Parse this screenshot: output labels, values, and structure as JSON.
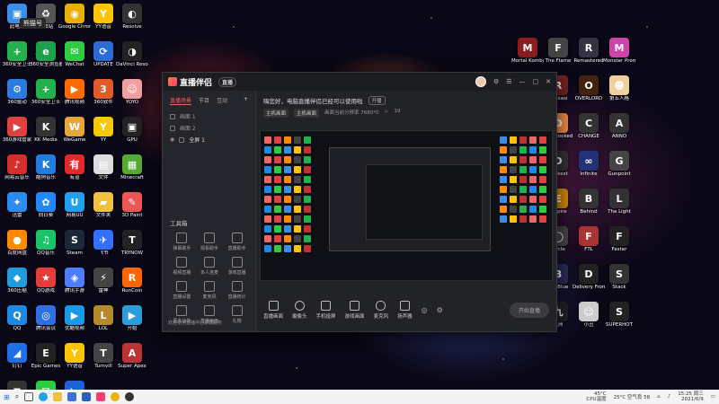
{
  "overlay": {
    "tag": "熊猫号"
  },
  "desktop_left": [
    [
      {
        "label": "此电脑",
        "color": "#3a8ee6",
        "glyph": "▣"
      },
      {
        "label": "360安全卫士",
        "color": "#22b14c",
        "glyph": "+"
      },
      {
        "label": "360驱动",
        "color": "#2d7be0",
        "glyph": "⚙"
      },
      {
        "label": "360游戏管家",
        "color": "#e04040",
        "glyph": "▶"
      },
      {
        "label": "网易云音乐",
        "color": "#d62d2d",
        "glyph": "♪"
      },
      {
        "label": "迅雷",
        "color": "#2a8cf0",
        "glyph": "✦"
      },
      {
        "label": "百度网盘",
        "color": "#ff8a00",
        "glyph": "●"
      },
      {
        "label": "360压缩",
        "color": "#1f9bde",
        "glyph": "◆"
      },
      {
        "label": "QQ",
        "color": "#1e88e5",
        "glyph": "Q"
      },
      {
        "label": "钉钉",
        "color": "#1d6fe8",
        "glyph": "◢"
      },
      {
        "label": "PS4",
        "color": "#333",
        "glyph": "◼"
      }
    ],
    [
      {
        "label": "回收站",
        "color": "#555",
        "glyph": "♻"
      },
      {
        "label": "360安全浏览器",
        "color": "#1da14a",
        "glyph": "e"
      },
      {
        "label": "360安全卫士",
        "color": "#22b14c",
        "glyph": "+"
      },
      {
        "label": "KK Media",
        "color": "#333",
        "glyph": "K"
      },
      {
        "label": "酷狗音乐",
        "color": "#1f7de0",
        "glyph": "K"
      },
      {
        "label": "向日葵",
        "color": "#2288ff",
        "glyph": "✿"
      },
      {
        "label": "QQ音乐",
        "color": "#19c36a",
        "glyph": "♫"
      },
      {
        "label": "QQ游戏",
        "color": "#e63b3b",
        "glyph": "★"
      },
      {
        "label": "腾讯会议",
        "color": "#2f6fe4",
        "glyph": "◎"
      },
      {
        "label": "Epic Games",
        "color": "#222",
        "glyph": "E"
      },
      {
        "label": "微信",
        "color": "#2ecc40",
        "glyph": "✉"
      }
    ],
    [
      {
        "label": "Google Chrome",
        "color": "#e8b004",
        "glyph": "◉"
      },
      {
        "label": "WeChat",
        "color": "#2ecc40",
        "glyph": "✉"
      },
      {
        "label": "腾讯视频",
        "color": "#ff6b00",
        "glyph": "▶"
      },
      {
        "label": "WeGame",
        "color": "#e6a63a",
        "glyph": "W"
      },
      {
        "label": "有道",
        "color": "#e02a2a",
        "glyph": "有"
      },
      {
        "label": "网易UU",
        "color": "#21a0f0",
        "glyph": "U"
      },
      {
        "label": "Steam",
        "color": "#1b2838",
        "glyph": "S"
      },
      {
        "label": "腾讯手游",
        "color": "#4d7cff",
        "glyph": "◈"
      },
      {
        "label": "优酷视频",
        "color": "#1a9ae6",
        "glyph": "▶"
      },
      {
        "label": "YY语音",
        "color": "#ffc400",
        "glyph": "Y"
      },
      {
        "label": "腾讯游戏",
        "color": "#1e63d6",
        "glyph": "◣"
      }
    ],
    [
      {
        "label": "YY语音",
        "color": "#ffc400",
        "glyph": "Y"
      },
      {
        "label": "UPDATE",
        "color": "#2b6bd6",
        "glyph": "⟳"
      },
      {
        "label": "360软件",
        "color": "#e05a2a",
        "glyph": "3"
      },
      {
        "label": "YY",
        "color": "#f5c800",
        "glyph": "Y"
      },
      {
        "label": "文件",
        "color": "#ddd",
        "glyph": "▤"
      },
      {
        "label": "文件夹",
        "color": "#f0c040",
        "glyph": "▰"
      },
      {
        "label": "飞书",
        "color": "#3370ff",
        "glyph": "✈"
      },
      {
        "label": "雷神",
        "color": "#444",
        "glyph": "⚡"
      },
      {
        "label": "LOL",
        "color": "#b48a2c",
        "glyph": "L"
      },
      {
        "label": "Turnvill",
        "color": "#444",
        "glyph": "T"
      }
    ],
    [
      {
        "label": "Resolve",
        "color": "#333",
        "glyph": "◐"
      },
      {
        "label": "DaVinci Resolve",
        "color": "#222",
        "glyph": "◑"
      },
      {
        "label": "YOYO",
        "color": "#f0a0a0",
        "glyph": "☺"
      },
      {
        "label": "GPU",
        "color": "#222",
        "glyph": "▣"
      },
      {
        "label": "Minecraft",
        "color": "#5a3",
        "glyph": "▦"
      },
      {
        "label": "3D Paint",
        "color": "#e55",
        "glyph": "✎"
      },
      {
        "label": "TRYNOW",
        "color": "#222",
        "glyph": "T"
      },
      {
        "label": "RunCoin",
        "color": "#f60",
        "glyph": "R"
      },
      {
        "label": "开始",
        "color": "#2d9cdb",
        "glyph": "▶"
      },
      {
        "label": "Super Apex",
        "color": "#b33",
        "glyph": "A"
      }
    ]
  ],
  "desktop_right": [
    [
      {
        "label": "Mortal Kombat",
        "color": "#8a1e1e",
        "glyph": "M"
      },
      {
        "label": "Merge",
        "color": "#e66",
        "glyph": "✚"
      },
      {
        "label": "游戏",
        "color": "#b33",
        "glyph": "◆"
      },
      {
        "label": "Conqueror",
        "color": "#6a4",
        "glyph": "C"
      },
      {
        "label": "BIOLOGY",
        "color": "#333",
        "glyph": "B"
      },
      {
        "label": "Not For Broadcast",
        "color": "#c33",
        "glyph": "N"
      },
      {
        "label": "Shattered",
        "color": "#3a5ba0",
        "glyph": "S"
      },
      {
        "label": "Punch Club",
        "color": "#a22",
        "glyph": "P"
      }
    ],
    [
      {
        "label": "The Flame",
        "color": "#444",
        "glyph": "F"
      },
      {
        "label": "Raksasi",
        "color": "#722",
        "glyph": "R"
      },
      {
        "label": "Overcooked",
        "color": "#e84",
        "glyph": "O"
      },
      {
        "label": "Darkest",
        "color": "#333",
        "glyph": "D"
      },
      {
        "label": "Empire",
        "color": "#c80",
        "glyph": "E"
      },
      {
        "label": "Circle",
        "color": "#444",
        "glyph": "◯"
      },
      {
        "label": "Big Blue",
        "color": "#2a2a5a",
        "glyph": "B"
      },
      {
        "label": "九州",
        "color": "#222",
        "glyph": "九"
      }
    ],
    [
      {
        "label": "Remastered",
        "color": "#334",
        "glyph": "R"
      },
      {
        "label": "OVERLORD",
        "color": "#421",
        "glyph": "O"
      },
      {
        "label": "CHANGE",
        "color": "#333",
        "glyph": "C"
      },
      {
        "label": "Infinite",
        "color": "#237",
        "glyph": "∞"
      },
      {
        "label": "Behind",
        "color": "#333",
        "glyph": "B"
      },
      {
        "label": "FTL",
        "color": "#a33",
        "glyph": "F"
      },
      {
        "label": "Delivery From",
        "color": "#222",
        "glyph": "D"
      },
      {
        "label": "小丑",
        "color": "#ccc",
        "glyph": "☺"
      }
    ],
    [
      {
        "label": "Monster Prom",
        "color": "#c4a",
        "glyph": "M"
      },
      {
        "label": "第五人格",
        "color": "#f0d0a0",
        "glyph": "☻"
      },
      {
        "label": "ANNO",
        "color": "#333",
        "glyph": "A"
      },
      {
        "label": "Gunpoint",
        "color": "#444",
        "glyph": "G"
      },
      {
        "label": "The Light",
        "color": "#333",
        "glyph": "L"
      },
      {
        "label": "Faster",
        "color": "#222",
        "glyph": "F"
      },
      {
        "label": "Stack",
        "color": "#333",
        "glyph": "S"
      },
      {
        "label": "SUPERHOT",
        "color": "#222",
        "glyph": "S"
      }
    ]
  ],
  "app": {
    "brand": "直播伴侣",
    "version_badge": "直播",
    "tabs": [
      "直播场景",
      "节目",
      "互动"
    ],
    "scenes": [
      "画面 1",
      "画面 2",
      "全屏 1"
    ],
    "tools_title": "工具箱",
    "tools": [
      "弹幕助手",
      "观看助手",
      "直播助手",
      "视频直播",
      "多人连麦",
      "游戏直播",
      "直播设置",
      "麦克风",
      "直播统计",
      "更多功能",
      "直播画面",
      "礼物"
    ],
    "footer_tip": "欢迎使用直播伴侣录屏服务",
    "info_title": "嗨您好，电脑直播伴侣已经可以使用啦",
    "info_pill": "开播",
    "meta_chips": [
      "主机画面",
      "主机画面"
    ],
    "meta_text": "画面当前分辨率 7680*0",
    "meta_count": "19",
    "bottom_items": [
      "直播画面",
      "摄像头",
      "手机投屏",
      "游戏画面",
      "麦克风",
      "扬声器"
    ],
    "start_label": "开始直播"
  },
  "taskbar": {
    "weather": "25°C 空气良 58",
    "cpu_temp": "45°C",
    "cpu_label": "CPU温度",
    "time": "15:25 周三",
    "date": "2021/6/9"
  }
}
